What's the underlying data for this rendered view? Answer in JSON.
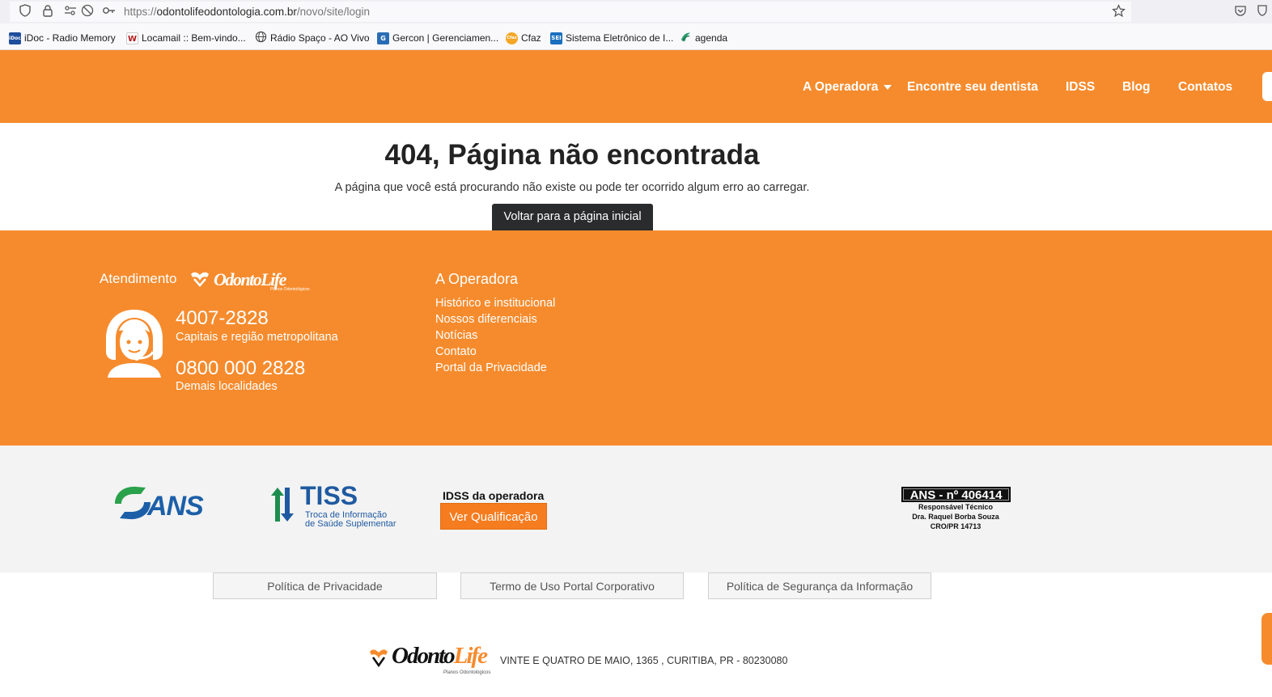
{
  "browser": {
    "url_scheme": "https://",
    "url_host": "odontolifeodontologia.com.br",
    "url_path": "/novo/site/login",
    "bookmarks": [
      {
        "label": "iDoc - Radio Memory",
        "color": "#1f4e9c",
        "glyph": "iDoc"
      },
      {
        "label": "Locamail :: Bem-vindo...",
        "color": "#ffffff",
        "glyph": "W"
      },
      {
        "label": "Rádio Spaço - AO Vivo",
        "color": "#ffffff",
        "glyph": "globe"
      },
      {
        "label": "Gercon | Gerenciamen...",
        "color": "#2a6db5",
        "glyph": "G"
      },
      {
        "label": "Cfaz",
        "color": "#f5a623",
        "glyph": "Cfaz"
      },
      {
        "label": "Sistema Eletrônico de I...",
        "color": "#1a6fc0",
        "glyph": "SEI"
      },
      {
        "label": "agenda",
        "color": "#ffffff",
        "glyph": "agenda"
      }
    ]
  },
  "nav": {
    "items": [
      "A Operadora",
      "Encontre seu dentista",
      "IDSS",
      "Blog",
      "Contatos"
    ]
  },
  "error": {
    "title": "404, Página não encontrada",
    "message": "A página que você está procurando não existe ou pode ter ocorrido algum erro ao carregar.",
    "button": "Voltar para a página inicial"
  },
  "footer": {
    "attendance_label": "Atendimento",
    "logo_text": "OdontoLife",
    "logo_sub": "Planos Odontológicos",
    "phone1": "4007-2828",
    "phone1_caption": "Capitais e região metropolitana",
    "phone2": "0800 000 2828",
    "phone2_caption": "Demais localidades",
    "operadora_title": "A Operadora",
    "operadora_links": [
      "Histórico e institucional",
      "Nossos diferenciais",
      "Notícias",
      "Contato",
      "Portal da Privacidade"
    ]
  },
  "partners": {
    "ans_text": "ANS",
    "tiss_title": "TISS",
    "tiss_line1": "Troca de Informação",
    "tiss_line2": "de Saúde Suplementar",
    "idss_title": "IDSS da operadora",
    "idss_button": "Ver Qualificação",
    "ans_number": "ANS - nº 406414",
    "resp_line1": "Responsável Técnico",
    "resp_line2": "Dra. Raquel Borba Souza",
    "resp_line3": "CRO/PR 14713"
  },
  "legal": {
    "links": [
      "Política de Privacidade",
      "Termo de Uso Portal Corporativo",
      "Política de Segurança da Informação"
    ],
    "address": "VINTE E QUATRO DE MAIO, 1365 , CURITIBA, PR - 80230080",
    "logo_odonto": "Odonto",
    "logo_life": "Life",
    "logo_sub": "Planos Odontológicos"
  },
  "colors": {
    "brand_orange": "#f68b2d",
    "ans_green": "#2aa14b",
    "ans_blue": "#1c5fa8",
    "tiss_green": "#1d8d4f",
    "tiss_blue": "#1f5aa0"
  }
}
